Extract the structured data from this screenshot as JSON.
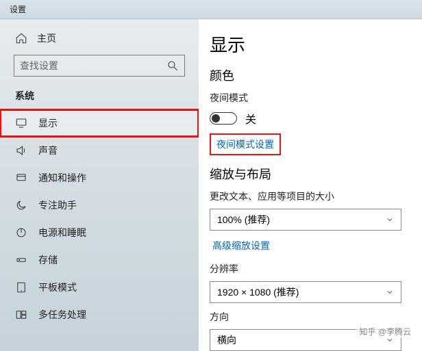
{
  "titlebar": {
    "title": "设置"
  },
  "sidebar": {
    "home_label": "主页",
    "search_placeholder": "查找设置",
    "section_title": "系统",
    "items": [
      {
        "label": "显示"
      },
      {
        "label": "声音"
      },
      {
        "label": "通知和操作"
      },
      {
        "label": "专注助手"
      },
      {
        "label": "电源和睡眠"
      },
      {
        "label": "存储"
      },
      {
        "label": "平板模式"
      },
      {
        "label": "多任务处理"
      }
    ]
  },
  "main": {
    "page_title": "显示",
    "color_heading": "颜色",
    "night_mode_label": "夜间模式",
    "night_mode_state": "关",
    "night_mode_settings_link": "夜间模式设置",
    "scale_heading": "缩放与布局",
    "scale_label": "更改文本、应用等项目的大小",
    "scale_value": "100% (推荐)",
    "advanced_scale_link": "高级缩放设置",
    "resolution_label": "分辨率",
    "resolution_value": "1920 × 1080 (推荐)",
    "orientation_label": "方向",
    "orientation_value": "横向"
  },
  "watermark": "知乎 @李腾云"
}
